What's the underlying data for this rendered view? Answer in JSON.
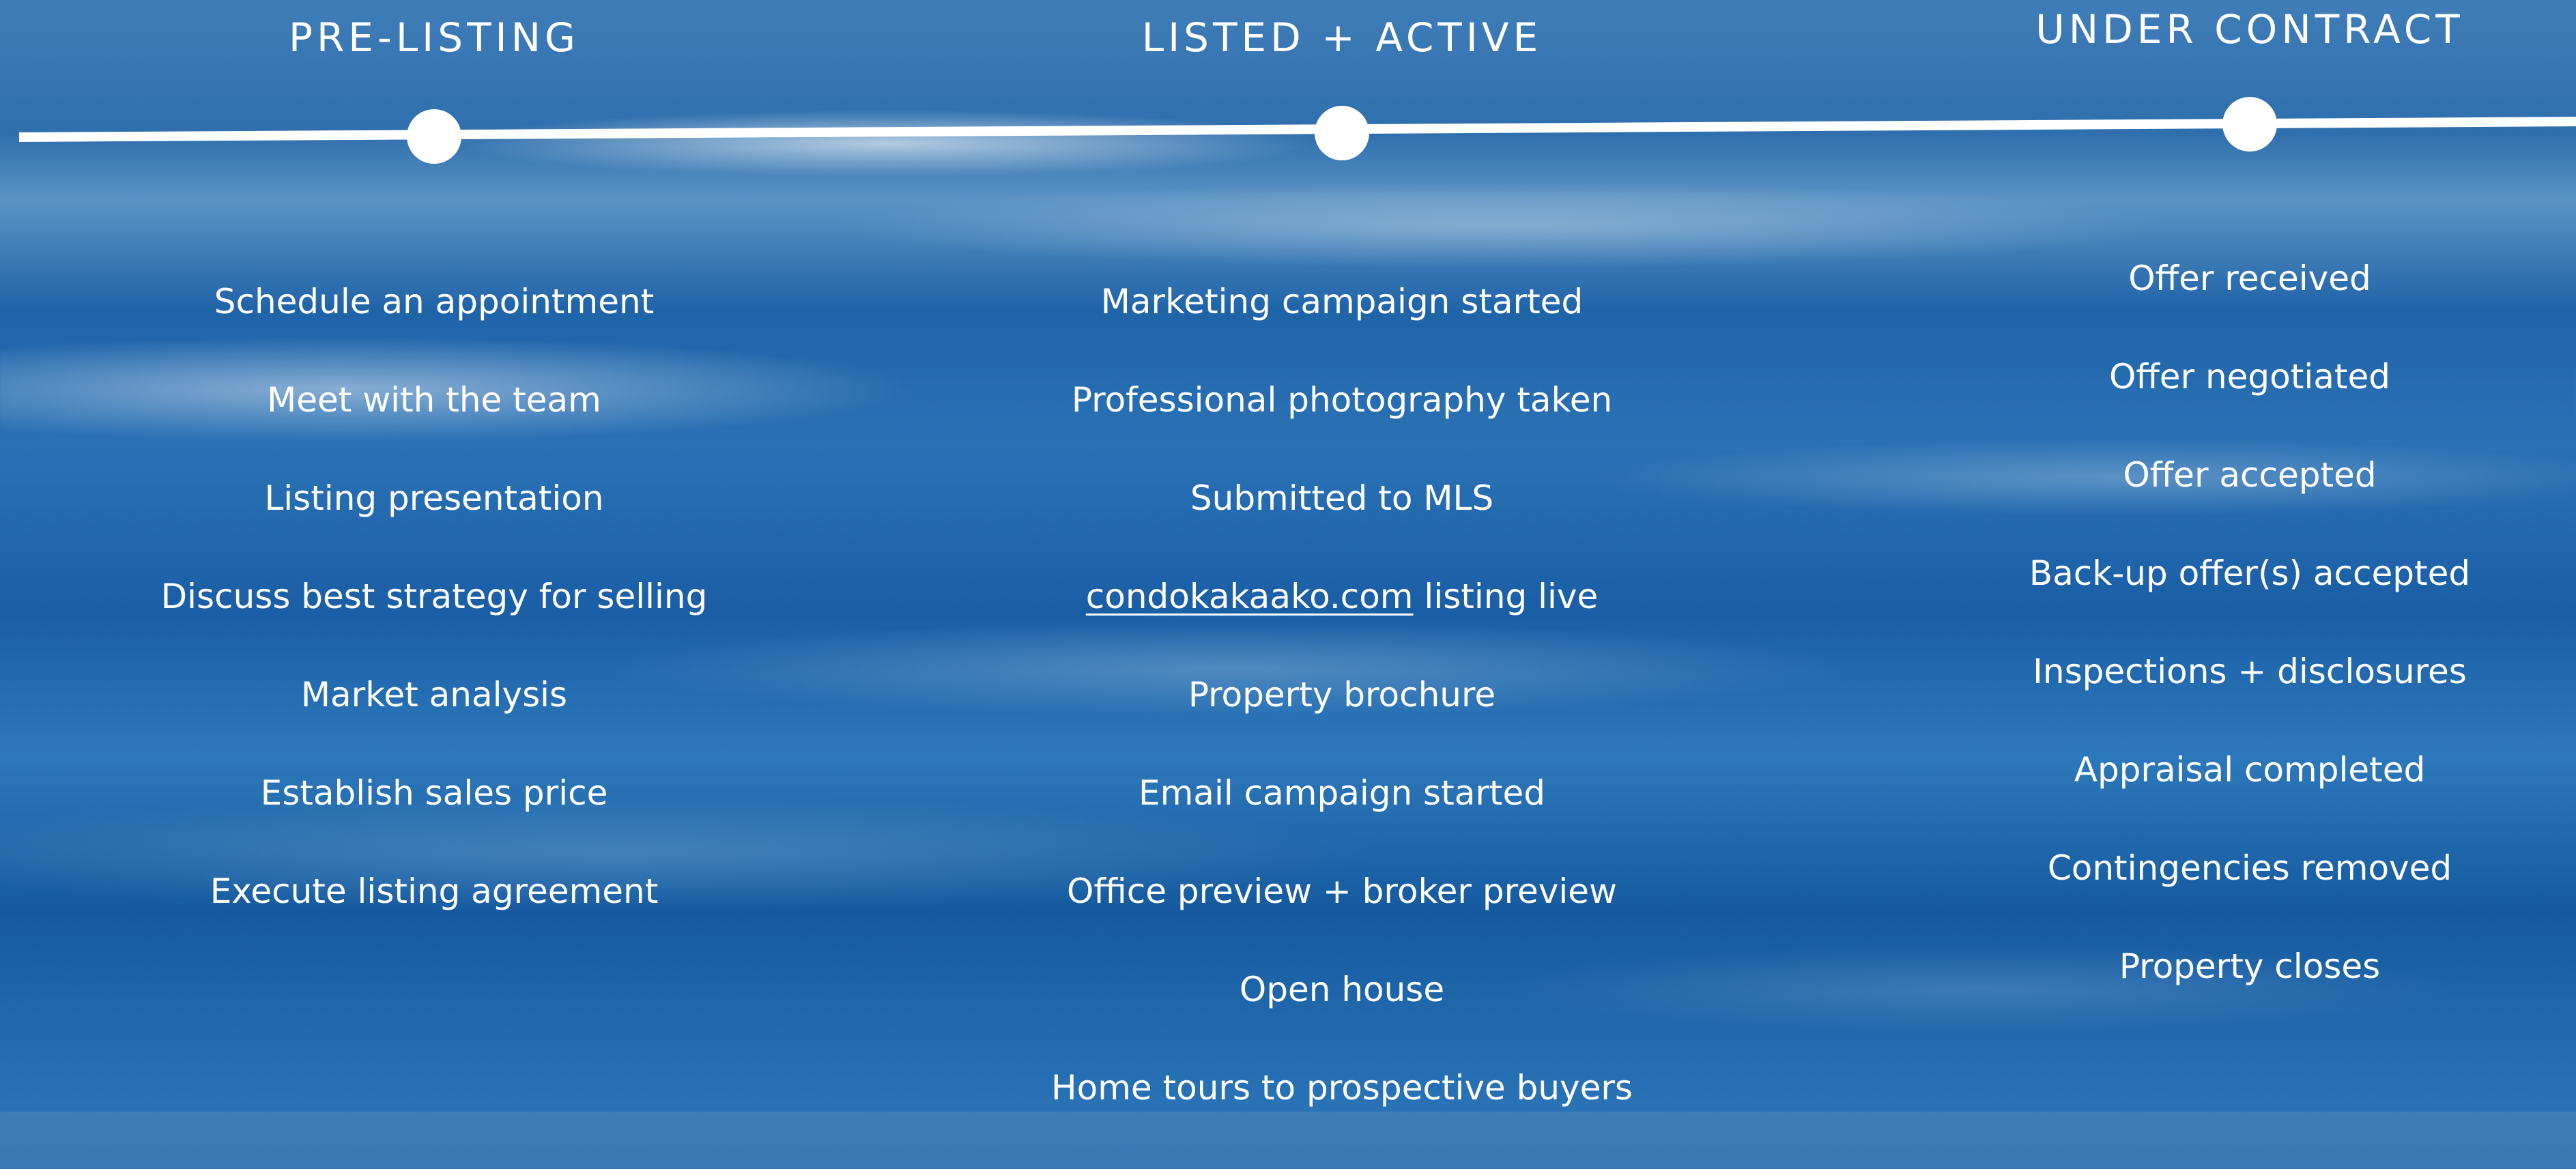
{
  "stages": [
    {
      "title": "PRE-LISTING",
      "items": [
        "Schedule an appointment",
        "Meet with the team",
        "Listing presentation",
        "Discuss best strategy for selling",
        "Market analysis",
        "Establish sales price",
        "Execute listing agreement"
      ]
    },
    {
      "title": "LISTED + ACTIVE",
      "items": [
        "Marketing campaign started",
        "Professional photography taken",
        "Submitted to MLS",
        " listing live",
        "Property brochure",
        "Email campaign started",
        "Office preview + broker preview",
        "Open house",
        "Home tours to prospective buyers"
      ],
      "link_text": "condokakaako.com"
    },
    {
      "title": "UNDER CONTRACT",
      "items": [
        "Offer received",
        "Offer negotiated",
        "Offer accepted",
        "Back-up offer(s) accepted",
        "Inspections + disclosures",
        "Appraisal completed",
        "Contingencies removed",
        "Property closes"
      ]
    }
  ],
  "colors": {
    "text": "#ffffff",
    "timeline": "#ffffff",
    "background_deep": "#1a5ea6",
    "background_light": "#dce8f2"
  }
}
